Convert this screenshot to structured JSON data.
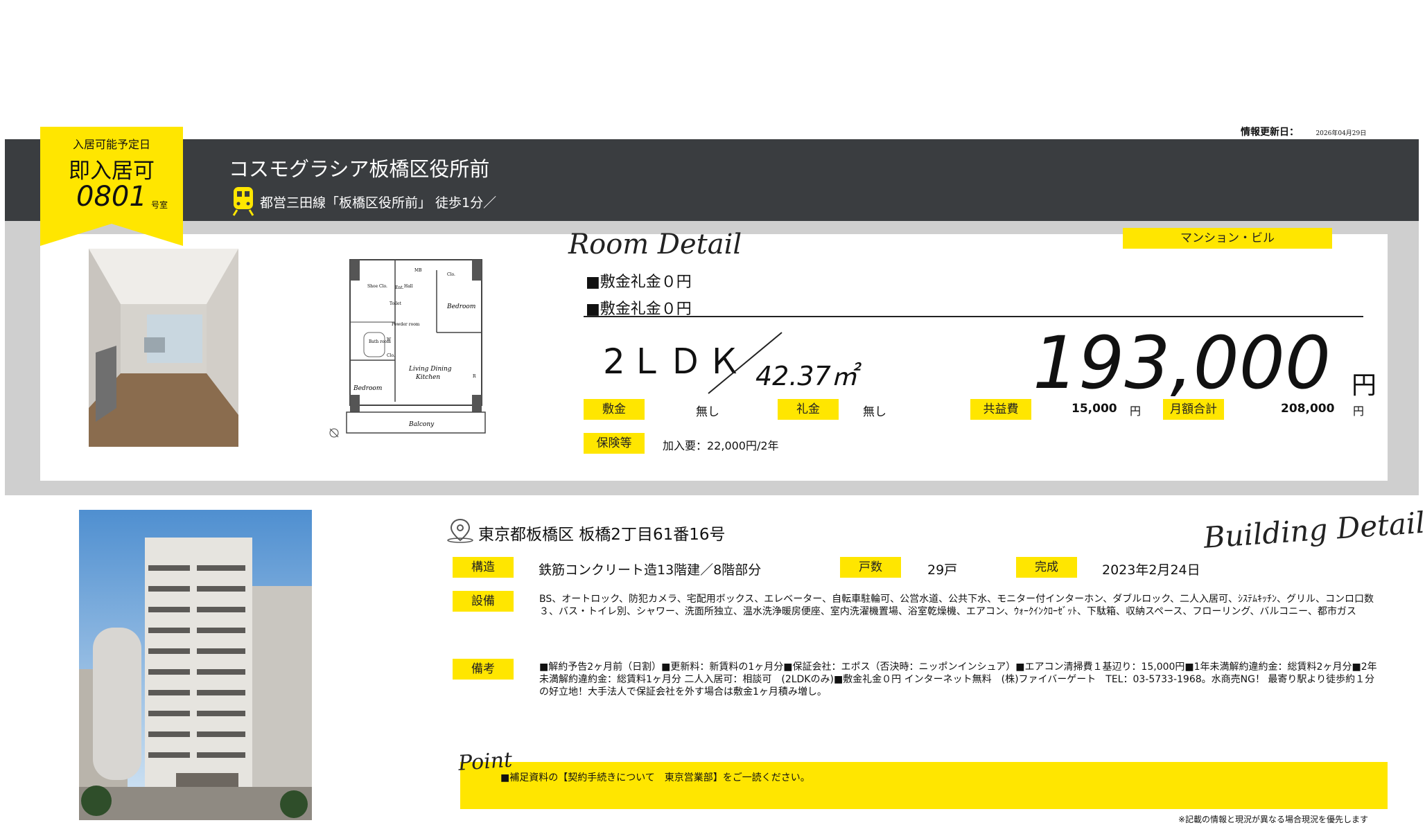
{
  "info_update": {
    "label": "情報更新日：",
    "date": "2026年04月29日"
  },
  "badge": {
    "move_in_label": "入居可能予定日",
    "move_in_value": "即入居可",
    "room_number": "0801",
    "room_suffix": "号室"
  },
  "header": {
    "building_name": "コスモグラシア板橋区役所前",
    "access": "都営三田線「板橋区役所前」 徒歩1分／"
  },
  "room_detail": {
    "heading": "Room Detail",
    "type_tag": "マンション・ビル",
    "notes": [
      "■敷金礼金０円",
      "■敷金礼金０円"
    ],
    "layout": "2ＬＤＫ",
    "area": "42.37㎡",
    "rent": "193,000",
    "rent_unit": "円",
    "fees": [
      {
        "label": "敷金",
        "value": "無し",
        "unit": ""
      },
      {
        "label": "礼金",
        "value": "無し",
        "unit": ""
      },
      {
        "label": "共益費",
        "value": "15,000",
        "unit": "円"
      },
      {
        "label": "月額合計",
        "value": "208,000",
        "unit": "円"
      }
    ],
    "insurance": {
      "label": "保険等",
      "value": "加入要：22,000円/2年"
    }
  },
  "floorplan": {
    "labels": [
      "Bedroom",
      "Living Dining Kitchen",
      "Bedroom",
      "Balcony",
      "MB",
      "Clo.",
      "Hall",
      "Ent.",
      "Toilet",
      "Powder room",
      "Bath room",
      "W",
      "Clo.",
      "Shoe Clo.",
      "R"
    ]
  },
  "building_detail": {
    "heading": "Building Detail",
    "address": "東京都板橋区 板橋2丁目61番16号",
    "structure_label": "構造",
    "structure": "鉄筋コンクリート造13階建／8階部分",
    "units_label": "戸数",
    "units": "29戸",
    "built_label": "完成",
    "built": "2023年2月24日",
    "equipment_label": "設備",
    "equipment": "BS、オートロック、防犯カメラ、宅配用ボックス、エレベーター、自転車駐輪可、公営水道、公共下水、モニター付インターホン、ダブルロック、二人入居可、ｼｽﾃﾑｷｯﾁﾝ、グリル、コンロ口数３、バス・トイレ別、シャワー、洗面所独立、温水洗浄暖房便座、室内洗濯機置場、浴室乾燥機、エアコン、ｳｫｰｸｲﾝｸﾛｰｾﾞｯﾄ、下駄箱、収納スペース、フローリング、バルコニー、都市ガス",
    "remarks_label": "備考",
    "remarks": "■解約予告2ヶ月前（日割）■更新料：新賃料の1ヶ月分■保証会社：エポス（否決時：ニッポンインシュア）■エアコン清掃費１基辺り：15,000円■1年未満解約違約金：総賃料2ヶ月分■2年未満解約違約金：総賃料1ヶ月分 二人入居可：相談可　(2LDKのみ)■敷金礼金０円 インターネット無料　(株)ファイバーゲート　TEL：03-5733-1968。水商売NG！ 最寄り駅より徒歩約１分の好立地！大手法人で保証会社を外す場合は敷金1ヶ月積み増し。"
  },
  "point": {
    "heading": "Point",
    "text": "■補足資料の【契約手続きについて　東京営業部】をご一読ください。"
  },
  "footer_note": "※記載の情報と現況が異なる場合現況を優先します",
  "colors": {
    "accent": "#ffe600",
    "header_bg": "#3a3d40",
    "panel_bg": "#cfcfcf"
  }
}
